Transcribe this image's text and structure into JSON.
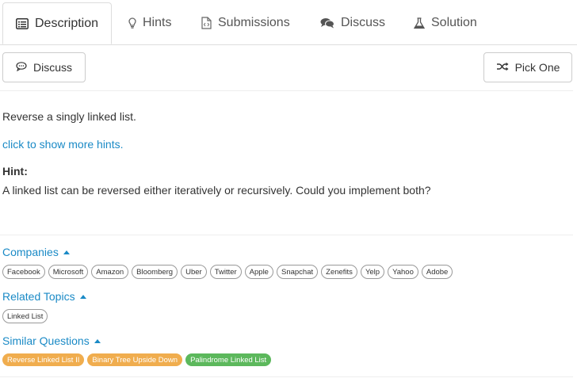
{
  "tabs": [
    {
      "label": "Description",
      "icon": "list-icon"
    },
    {
      "label": "Hints",
      "icon": "lightbulb-icon"
    },
    {
      "label": "Submissions",
      "icon": "file-code-icon"
    },
    {
      "label": "Discuss",
      "icon": "comments-icon"
    },
    {
      "label": "Solution",
      "icon": "flask-icon"
    }
  ],
  "toolbar": {
    "discuss_label": "Discuss",
    "pick_one_label": "Pick One"
  },
  "problem": {
    "statement": "Reverse a singly linked list.",
    "hints_link": "click to show more hints.",
    "hint_title": "Hint:",
    "hint_body": "A linked list can be reversed either iteratively or recursively. Could you implement both?"
  },
  "companies": {
    "title": "Companies",
    "tags": [
      "Facebook",
      "Microsoft",
      "Amazon",
      "Bloomberg",
      "Uber",
      "Twitter",
      "Apple",
      "Snapchat",
      "Zenefits",
      "Yelp",
      "Yahoo",
      "Adobe"
    ]
  },
  "related_topics": {
    "title": "Related Topics",
    "tags": [
      "Linked List"
    ]
  },
  "similar_questions": {
    "title": "Similar Questions",
    "tags": [
      {
        "label": "Reverse Linked List II",
        "color": "#f0ad4e"
      },
      {
        "label": "Binary Tree Upside Down",
        "color": "#f0ad4e"
      },
      {
        "label": "Palindrome Linked List",
        "color": "#5cb85c"
      }
    ]
  }
}
